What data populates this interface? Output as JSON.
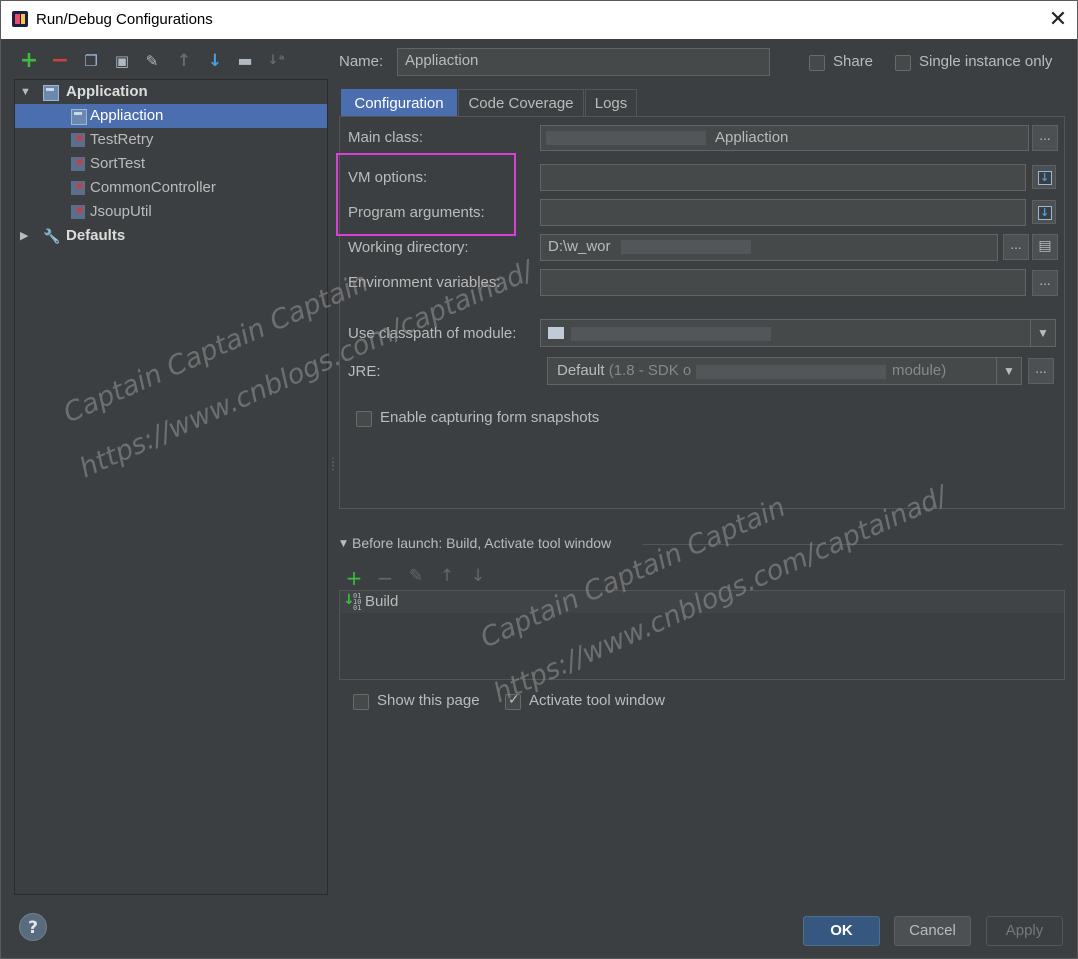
{
  "window": {
    "title": "Run/Debug Configurations"
  },
  "toolbar": {
    "icons": [
      "add-icon",
      "remove-icon",
      "copy-icon",
      "save-icon",
      "edit-defaults-icon",
      "move-up-icon",
      "move-down-icon",
      "folder-icon",
      "sort-icon"
    ]
  },
  "tree": {
    "group_application": "Application",
    "items": [
      {
        "label": "Appliaction",
        "selected": true
      },
      {
        "label": "TestRetry",
        "error": true
      },
      {
        "label": "SortTest",
        "error": true
      },
      {
        "label": "CommonController",
        "error": true
      },
      {
        "label": "JsoupUtil",
        "error": true
      }
    ],
    "group_defaults": "Defaults"
  },
  "header": {
    "name_label": "Name:",
    "name_value": "Appliaction",
    "share_label": "Share",
    "single_instance_label": "Single instance only"
  },
  "tabs": [
    {
      "label": "Configuration",
      "active": true
    },
    {
      "label": "Code Coverage"
    },
    {
      "label": "Logs"
    }
  ],
  "config": {
    "main_class_label": "Main class:",
    "main_class_value": "Appliaction",
    "vm_options_label": "VM options:",
    "vm_options_value": "",
    "program_args_label": "Program arguments:",
    "program_args_value": "",
    "working_dir_label": "Working directory:",
    "working_dir_value": "D:\\w_wor",
    "env_vars_label": "Environment variables:",
    "env_vars_value": "",
    "classpath_label": "Use classpath of module:",
    "jre_label": "JRE:",
    "jre_value": "Default",
    "jre_detail_left": "(1.8 - SDK o",
    "jre_detail_right": "module)",
    "capture_snapshots_label": "Enable capturing form snapshots",
    "ellipsis": "..."
  },
  "before_launch": {
    "header": "Before launch: Build, Activate tool window",
    "items": [
      "Build"
    ],
    "show_page_label": "Show this page",
    "activate_tool_window_label": "Activate tool window"
  },
  "buttons": {
    "ok": "OK",
    "cancel": "Cancel",
    "apply": "Apply",
    "help": "?"
  },
  "watermark": {
    "text1": "Captain  Captain  Captain",
    "url": "https://www.cnblogs.com/captainad/"
  },
  "colors": {
    "selection": "#4b6eaf",
    "highlight_box": "#d641d6",
    "add": "#3dbb3d",
    "remove": "#d04040",
    "move_down": "#4a9fe0"
  }
}
